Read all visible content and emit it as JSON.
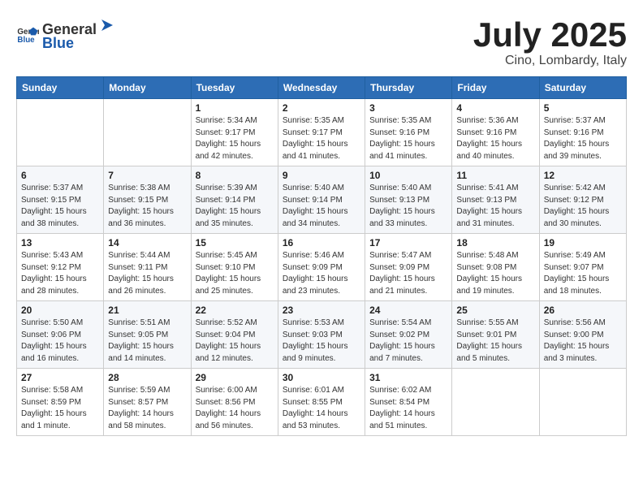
{
  "header": {
    "logo_general": "General",
    "logo_blue": "Blue",
    "month_year": "July 2025",
    "location": "Cino, Lombardy, Italy"
  },
  "weekdays": [
    "Sunday",
    "Monday",
    "Tuesday",
    "Wednesday",
    "Thursday",
    "Friday",
    "Saturday"
  ],
  "weeks": [
    [
      {
        "day": "",
        "info": ""
      },
      {
        "day": "",
        "info": ""
      },
      {
        "day": "1",
        "info": "Sunrise: 5:34 AM\nSunset: 9:17 PM\nDaylight: 15 hours\nand 42 minutes."
      },
      {
        "day": "2",
        "info": "Sunrise: 5:35 AM\nSunset: 9:17 PM\nDaylight: 15 hours\nand 41 minutes."
      },
      {
        "day": "3",
        "info": "Sunrise: 5:35 AM\nSunset: 9:16 PM\nDaylight: 15 hours\nand 41 minutes."
      },
      {
        "day": "4",
        "info": "Sunrise: 5:36 AM\nSunset: 9:16 PM\nDaylight: 15 hours\nand 40 minutes."
      },
      {
        "day": "5",
        "info": "Sunrise: 5:37 AM\nSunset: 9:16 PM\nDaylight: 15 hours\nand 39 minutes."
      }
    ],
    [
      {
        "day": "6",
        "info": "Sunrise: 5:37 AM\nSunset: 9:15 PM\nDaylight: 15 hours\nand 38 minutes."
      },
      {
        "day": "7",
        "info": "Sunrise: 5:38 AM\nSunset: 9:15 PM\nDaylight: 15 hours\nand 36 minutes."
      },
      {
        "day": "8",
        "info": "Sunrise: 5:39 AM\nSunset: 9:14 PM\nDaylight: 15 hours\nand 35 minutes."
      },
      {
        "day": "9",
        "info": "Sunrise: 5:40 AM\nSunset: 9:14 PM\nDaylight: 15 hours\nand 34 minutes."
      },
      {
        "day": "10",
        "info": "Sunrise: 5:40 AM\nSunset: 9:13 PM\nDaylight: 15 hours\nand 33 minutes."
      },
      {
        "day": "11",
        "info": "Sunrise: 5:41 AM\nSunset: 9:13 PM\nDaylight: 15 hours\nand 31 minutes."
      },
      {
        "day": "12",
        "info": "Sunrise: 5:42 AM\nSunset: 9:12 PM\nDaylight: 15 hours\nand 30 minutes."
      }
    ],
    [
      {
        "day": "13",
        "info": "Sunrise: 5:43 AM\nSunset: 9:12 PM\nDaylight: 15 hours\nand 28 minutes."
      },
      {
        "day": "14",
        "info": "Sunrise: 5:44 AM\nSunset: 9:11 PM\nDaylight: 15 hours\nand 26 minutes."
      },
      {
        "day": "15",
        "info": "Sunrise: 5:45 AM\nSunset: 9:10 PM\nDaylight: 15 hours\nand 25 minutes."
      },
      {
        "day": "16",
        "info": "Sunrise: 5:46 AM\nSunset: 9:09 PM\nDaylight: 15 hours\nand 23 minutes."
      },
      {
        "day": "17",
        "info": "Sunrise: 5:47 AM\nSunset: 9:09 PM\nDaylight: 15 hours\nand 21 minutes."
      },
      {
        "day": "18",
        "info": "Sunrise: 5:48 AM\nSunset: 9:08 PM\nDaylight: 15 hours\nand 19 minutes."
      },
      {
        "day": "19",
        "info": "Sunrise: 5:49 AM\nSunset: 9:07 PM\nDaylight: 15 hours\nand 18 minutes."
      }
    ],
    [
      {
        "day": "20",
        "info": "Sunrise: 5:50 AM\nSunset: 9:06 PM\nDaylight: 15 hours\nand 16 minutes."
      },
      {
        "day": "21",
        "info": "Sunrise: 5:51 AM\nSunset: 9:05 PM\nDaylight: 15 hours\nand 14 minutes."
      },
      {
        "day": "22",
        "info": "Sunrise: 5:52 AM\nSunset: 9:04 PM\nDaylight: 15 hours\nand 12 minutes."
      },
      {
        "day": "23",
        "info": "Sunrise: 5:53 AM\nSunset: 9:03 PM\nDaylight: 15 hours\nand 9 minutes."
      },
      {
        "day": "24",
        "info": "Sunrise: 5:54 AM\nSunset: 9:02 PM\nDaylight: 15 hours\nand 7 minutes."
      },
      {
        "day": "25",
        "info": "Sunrise: 5:55 AM\nSunset: 9:01 PM\nDaylight: 15 hours\nand 5 minutes."
      },
      {
        "day": "26",
        "info": "Sunrise: 5:56 AM\nSunset: 9:00 PM\nDaylight: 15 hours\nand 3 minutes."
      }
    ],
    [
      {
        "day": "27",
        "info": "Sunrise: 5:58 AM\nSunset: 8:59 PM\nDaylight: 15 hours\nand 1 minute."
      },
      {
        "day": "28",
        "info": "Sunrise: 5:59 AM\nSunset: 8:57 PM\nDaylight: 14 hours\nand 58 minutes."
      },
      {
        "day": "29",
        "info": "Sunrise: 6:00 AM\nSunset: 8:56 PM\nDaylight: 14 hours\nand 56 minutes."
      },
      {
        "day": "30",
        "info": "Sunrise: 6:01 AM\nSunset: 8:55 PM\nDaylight: 14 hours\nand 53 minutes."
      },
      {
        "day": "31",
        "info": "Sunrise: 6:02 AM\nSunset: 8:54 PM\nDaylight: 14 hours\nand 51 minutes."
      },
      {
        "day": "",
        "info": ""
      },
      {
        "day": "",
        "info": ""
      }
    ]
  ]
}
